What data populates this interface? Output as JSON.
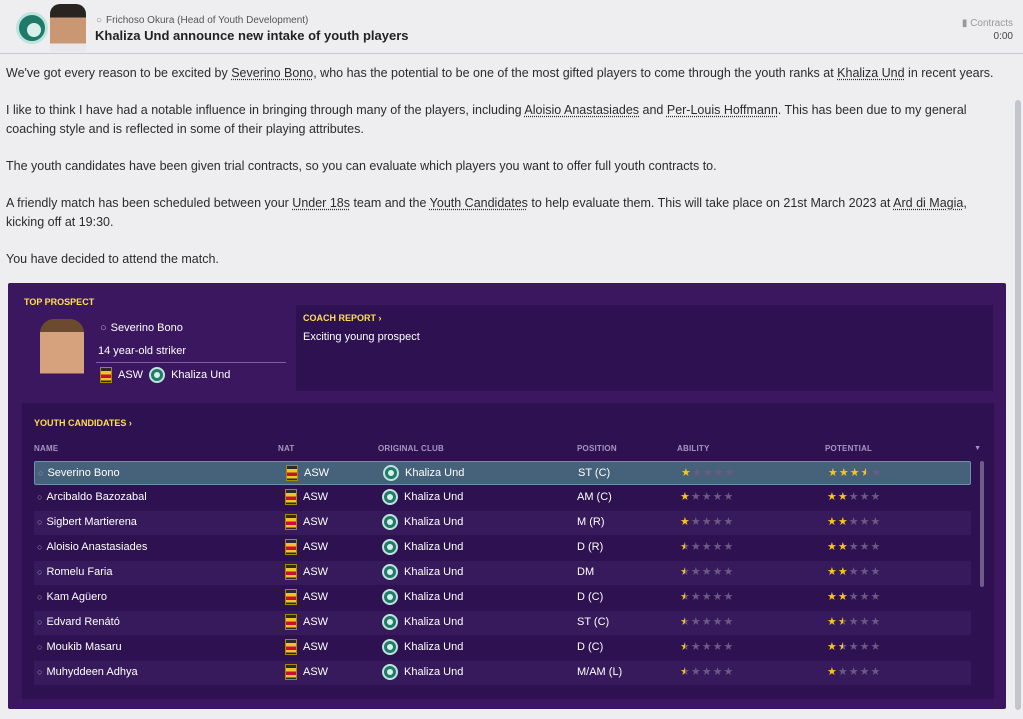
{
  "header": {
    "sender": "Frichoso Okura  (Head of Youth Development)",
    "subject": "Khaliza Und announce new intake of youth players",
    "tag": "Contracts",
    "time": "0:00"
  },
  "message": {
    "p1_before": "We've got every reason to be excited by ",
    "p1_link1": "Severino Bono",
    "p1_middle": ", who has the potential to be one of the most gifted players to come through the youth ranks at ",
    "p1_link2": "Khaliza Und",
    "p1_after": " in recent years.",
    "p2_before": "I like to think I have had a notable influence in bringing through many of the players, including ",
    "p2_link1": "Aloisio Anastasiades",
    "p2_middle": " and ",
    "p2_link2": "Per-Louis Hoffmann",
    "p2_after": ". This has been due to my general coaching style and is reflected in some of their playing attributes.",
    "p3": "The youth candidates have been given trial contracts, so you can evaluate which players you want to offer full youth contracts to.",
    "p4_before": "A friendly match has been scheduled between your ",
    "p4_link1": "Under 18s",
    "p4_middle1": " team and the ",
    "p4_link2": "Youth Candidates",
    "p4_middle2": " to help evaluate them. This will take place on 21st March 2023 at ",
    "p4_link3": "Ard di Magia",
    "p4_after": ", kicking off at 19:30.",
    "p5": "You have decided to attend the match."
  },
  "top_prospect": {
    "title": "TOP PROSPECT",
    "name": "Severino Bono",
    "description": "14 year-old striker",
    "nat": "ASW",
    "club": "Khaliza Und"
  },
  "coach_report": {
    "title": "COACH REPORT ›",
    "text": "Exciting young prospect"
  },
  "youth_candidates": {
    "title": "YOUTH CANDIDATES ›",
    "columns": {
      "name": "NAME",
      "nat": "NAT",
      "club": "ORIGINAL CLUB",
      "position": "POSITION",
      "ability": "ABILITY",
      "potential": "POTENTIAL"
    },
    "rows": [
      {
        "name": "Severino Bono",
        "nat": "ASW",
        "club": "Khaliza Und",
        "position": "ST (C)",
        "ability": 1,
        "potential": 3.5
      },
      {
        "name": "Arcibaldo Bazozabal",
        "nat": "ASW",
        "club": "Khaliza Und",
        "position": "AM (C)",
        "ability": 1,
        "potential": 2
      },
      {
        "name": "Sigbert Martierena",
        "nat": "ASW",
        "club": "Khaliza Und",
        "position": "M (R)",
        "ability": 1,
        "potential": 2
      },
      {
        "name": "Aloisio Anastasiades",
        "nat": "ASW",
        "club": "Khaliza Und",
        "position": "D (R)",
        "ability": 0.5,
        "potential": 2
      },
      {
        "name": "Romelu Faria",
        "nat": "ASW",
        "club": "Khaliza Und",
        "position": "DM",
        "ability": 0.5,
        "potential": 2
      },
      {
        "name": "Kam Agüero",
        "nat": "ASW",
        "club": "Khaliza Und",
        "position": "D (C)",
        "ability": 0.5,
        "potential": 2
      },
      {
        "name": "Edvard Renátó",
        "nat": "ASW",
        "club": "Khaliza Und",
        "position": "ST (C)",
        "ability": 0.5,
        "potential": 1.5
      },
      {
        "name": "Moukib Masaru",
        "nat": "ASW",
        "club": "Khaliza Und",
        "position": "D (C)",
        "ability": 0.5,
        "potential": 1.5
      },
      {
        "name": "Muhyddeen Adhya",
        "nat": "ASW",
        "club": "Khaliza Und",
        "position": "M/AM (L)",
        "ability": 0.5,
        "potential": 1
      }
    ]
  },
  "colors": {
    "panel": "#3b1760",
    "inner_panel": "#2e1150",
    "accent": "#ffe14a",
    "star": "#f5c518"
  }
}
